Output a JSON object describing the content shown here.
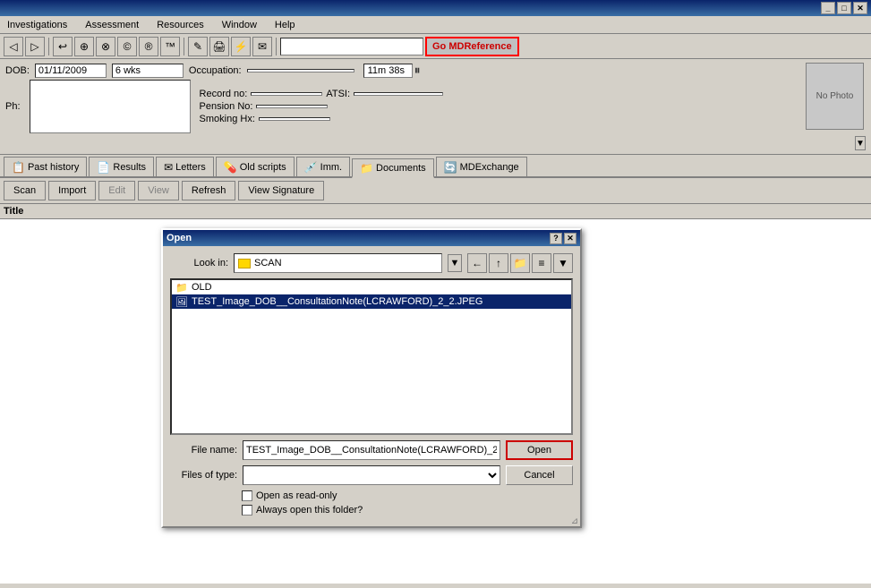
{
  "window": {
    "title": "",
    "title_bar_buttons": [
      "_",
      "□",
      "✕"
    ]
  },
  "menu": {
    "items": [
      "Investigations",
      "Assessment",
      "Resources",
      "Window",
      "Help"
    ]
  },
  "toolbar": {
    "search_placeholder": "",
    "go_btn_label": "Go MDReference"
  },
  "patient": {
    "dob_label": "DOB:",
    "dob_value": "01/11/2009",
    "age_value": "6 wks",
    "occupation_label": "Occupation:",
    "timer_value": "11m 38s",
    "ph_label": "Ph:",
    "record_no_label": "Record no:",
    "atsi_label": "ATSI:",
    "pension_label": "Pension No:",
    "smoking_label": "Smoking Hx:",
    "photo_text": "No Photo"
  },
  "tabs": [
    {
      "label": "Past history",
      "icon": "📋"
    },
    {
      "label": "Results",
      "icon": "📄"
    },
    {
      "label": "Letters",
      "icon": "✉"
    },
    {
      "label": "Old scripts",
      "icon": "💊"
    },
    {
      "label": "Imm.",
      "icon": "💉"
    },
    {
      "label": "Documents",
      "icon": "📁"
    },
    {
      "label": "MDExchange",
      "icon": "🔄"
    }
  ],
  "action_buttons": [
    {
      "label": "Scan",
      "disabled": false
    },
    {
      "label": "Import",
      "disabled": false
    },
    {
      "label": "Edit",
      "disabled": true
    },
    {
      "label": "View",
      "disabled": true
    },
    {
      "label": "Refresh",
      "disabled": false
    },
    {
      "label": "View Signature",
      "disabled": false
    }
  ],
  "table": {
    "column_title": "Title"
  },
  "dialog": {
    "title": "Open",
    "look_in_label": "Look in:",
    "look_in_value": "SCAN",
    "files": [
      {
        "name": "OLD",
        "type": "folder"
      },
      {
        "name": "TEST_Image_DOB__ConsultationNote(LCRAWFORD)_2_2.JPEG",
        "type": "file",
        "selected": true
      }
    ],
    "file_name_label": "File name:",
    "file_name_value": "TEST_Image_DOB__ConsultationNote(LCRAWFORD)_2",
    "files_of_type_label": "Files of type:",
    "files_of_type_value": "",
    "open_btn_label": "Open",
    "cancel_btn_label": "Cancel",
    "checkbox_readonly_label": "Open as read-only",
    "checkbox_always_label": "Always open this folder?",
    "title_btns": [
      "?",
      "✕"
    ]
  }
}
